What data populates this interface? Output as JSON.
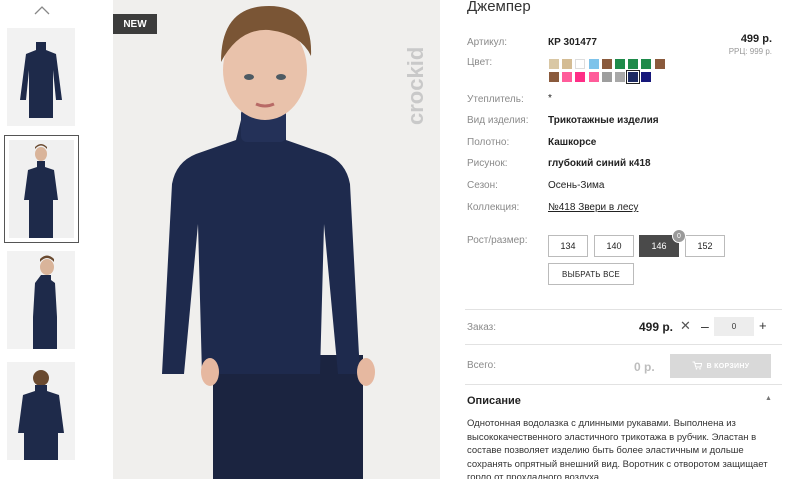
{
  "product": {
    "title": "Джемпер",
    "badge": "NEW",
    "brand_watermark": "crockid",
    "article_label": "Артикул:",
    "article_value": "КР 301477",
    "price": "499 р.",
    "rrc": "РРЦ: 999 р.",
    "color_label": "Цвет:",
    "insulation_label": "Утеплитель:",
    "insulation_value": "*",
    "type_label": "Вид изделия:",
    "type_value": "Трикотажные изделия",
    "fabric_label": "Полотно:",
    "fabric_value": "Кашкорсе",
    "pattern_label": "Рисунок:",
    "pattern_value": "глубокий синий к418",
    "season_label": "Сезон:",
    "season_value": "Осень-Зима",
    "collection_label": "Коллекция:",
    "collection_value": "№418 Звери в лесу"
  },
  "colors_row1": [
    "#d9c7a4",
    "#d4bc94",
    "#ffffff",
    "#7ec3ea",
    "#8a5a3c",
    "#1e8a4a",
    "#1e8a4a",
    "#1e8a4a",
    "#8a5a3c"
  ],
  "colors_row2": [
    "#8a5a3c",
    "#ff5c9a",
    "#ff2d86",
    "#ff5c9a",
    "#9e9e9e",
    "#a8a8a8",
    "#1d2a63",
    "#16177a"
  ],
  "selected_color_index": 6,
  "sizes": {
    "label": "Рост/размер:",
    "options": [
      "134",
      "140",
      "146",
      "152"
    ],
    "active_index": 2,
    "badge_count": "0",
    "select_all": "ВЫБРАТЬ ВСЕ"
  },
  "order": {
    "label": "Заказ:",
    "price": "499 р.",
    "qty": "0",
    "total_label": "Всего:",
    "total_price": "0 р.",
    "cart_button": "В КОРЗИНУ"
  },
  "description": {
    "heading": "Описание",
    "text": "Однотонная водолазка с длинными рукавами. Выполнена из высококачественного эластичного трикотажа в рубчик. Эластан в составе позволяет изделию быть более эластичным и дольше сохранять опрятный внешний вид. Воротник с отворотом защищает горло от прохладного воздуха."
  },
  "icons": {
    "thumb_up": "chevron-up-icon",
    "remove": "close-icon",
    "cart": "cart-icon",
    "collapse": "chevron-up-icon"
  }
}
